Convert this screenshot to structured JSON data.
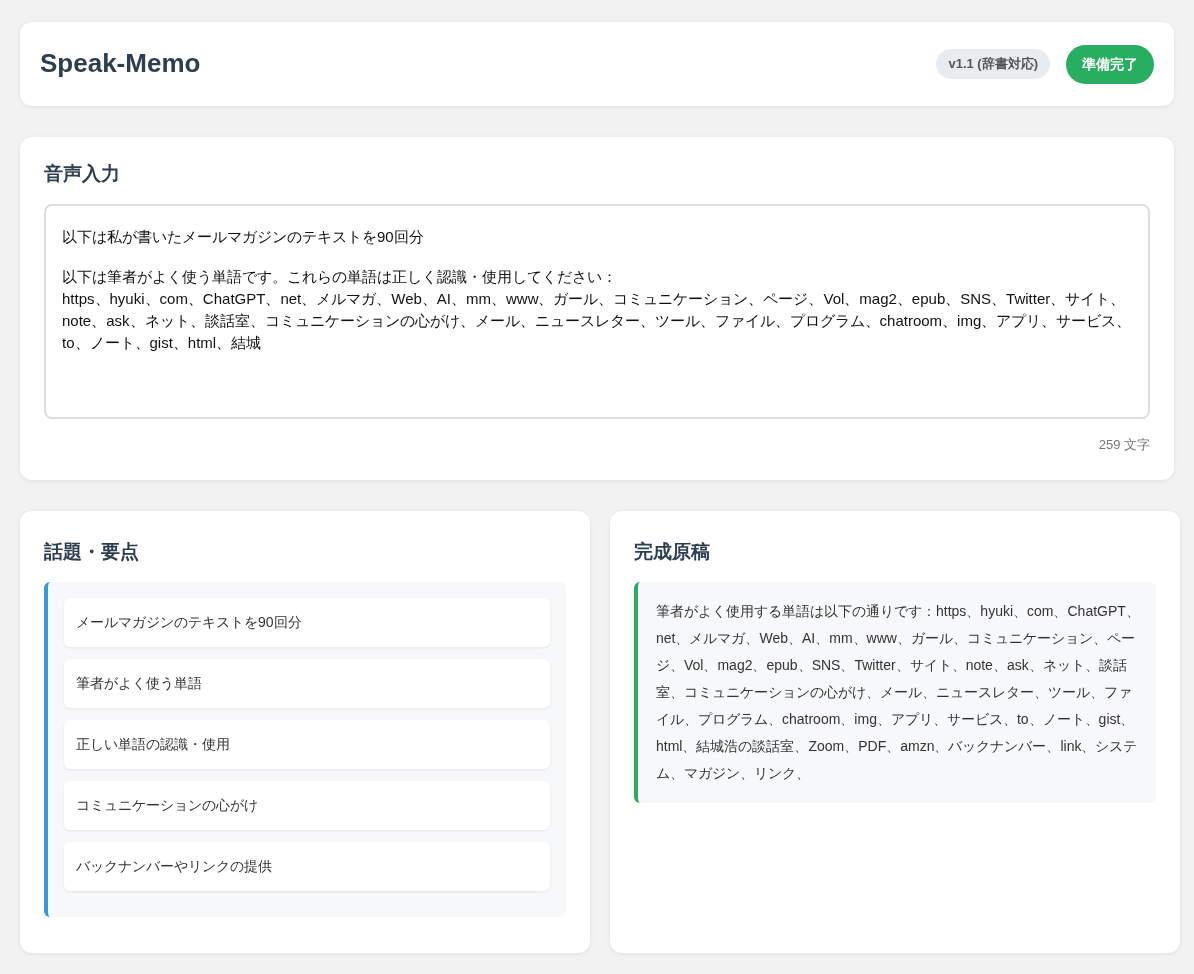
{
  "header": {
    "title": "Speak-Memo",
    "version_badge": "v1.1 (辞書対応)",
    "status_button": "準備完了"
  },
  "voice_input": {
    "heading": "音声入力",
    "paragraphs": [
      [
        "以下は私が書いたメールマガジンのテキストを90回分"
      ],
      [
        "以下は筆者がよく使う単語です。これらの単語は正しく認識・使用してください：",
        "https、hyuki、com、ChatGPT、net、メルマガ、Web、AI、mm、www、ガール、コミュニケーション、ページ、Vol、mag2、epub、SNS、Twitter、サイト、note、ask、ネット、談話室、コミュニケーションの心がけ、メール、ニュースレター、ツール、ファイル、プログラム、chatroom、img、アプリ、サービス、to、ノート、gist、html、結城"
      ]
    ],
    "char_count": "259 文字"
  },
  "topics": {
    "heading": "話題・要点",
    "items": [
      "メールマガジンのテキストを90回分",
      "筆者がよく使う単語",
      "正しい単語の認識・使用",
      "コミュニケーションの心がけ",
      "バックナンバーやリンクの提供"
    ]
  },
  "manuscript": {
    "heading": "完成原稿",
    "text": "筆者がよく使用する単語は以下の通りです：https、hyuki、com、ChatGPT、net、メルマガ、Web、AI、mm、www、ガール、コミュニケーション、ページ、Vol、mag2、epub、SNS、Twitter、サイト、note、ask、ネット、談話室、コミュニケーションの心がけ、メール、ニュースレター、ツール、ファイル、プログラム、chatroom、img、アプリ、サービス、to、ノート、gist、html、結城浩の談話室、Zoom、PDF、amzn、バックナンバー、link、システム、マガジン、リンク、"
  }
}
